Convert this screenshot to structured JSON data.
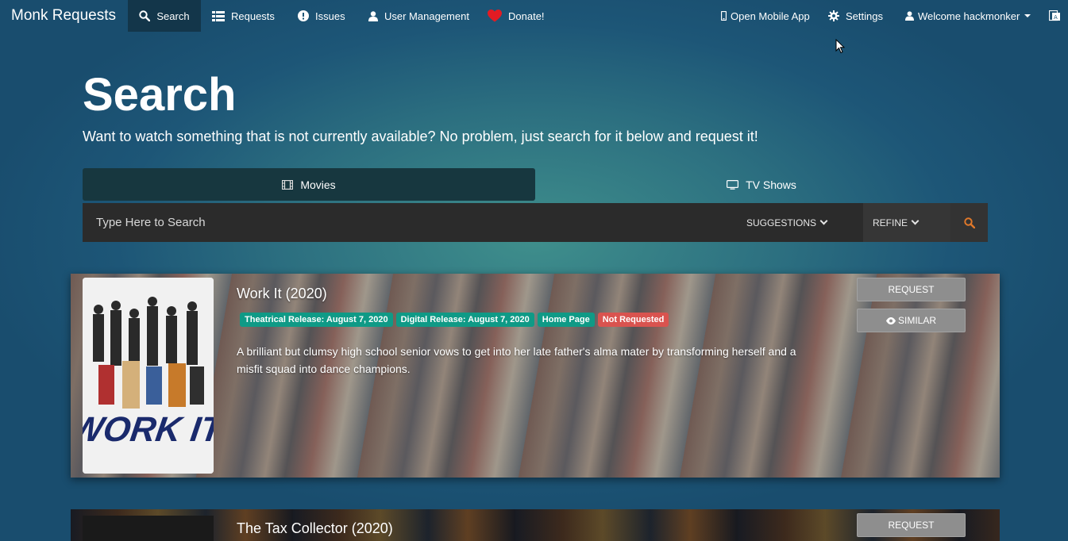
{
  "app": {
    "brand": "Monk Requests"
  },
  "nav": {
    "search": "Search",
    "requests": "Requests",
    "issues": "Issues",
    "user_management": "User Management",
    "donate": "Donate!",
    "mobile_app": "Open Mobile App",
    "settings": "Settings",
    "welcome": "Welcome hackmonker"
  },
  "hero": {
    "title": "Search",
    "subtitle": "Want to watch something that is not currently available? No problem, just search for it below and request it!"
  },
  "tabs": [
    {
      "label": "Movies",
      "active": true,
      "icon": "film-icon"
    },
    {
      "label": "TV Shows",
      "active": false,
      "icon": "tv-icon"
    }
  ],
  "search": {
    "placeholder": "Type Here to Search",
    "suggestions_label": "SUGGESTIONS",
    "refine_label": "REFINE"
  },
  "results": [
    {
      "title": "Work It (2020)",
      "badges": [
        {
          "text": "Theatrical Release: August 7, 2020",
          "color": "#0f9a86"
        },
        {
          "text": "Digital Release: August 7, 2020",
          "color": "#0f9a86"
        },
        {
          "text": "Home Page",
          "color": "#0f9a86"
        },
        {
          "text": "Not Requested",
          "color": "#d9534f"
        }
      ],
      "overview": "A brilliant but clumsy high school senior vows to get into her late father's alma mater by transforming herself and a misfit squad into dance champions.",
      "request_label": "REQUEST",
      "similar_label": "SIMILAR",
      "poster_text": "WORK IT"
    },
    {
      "title": "The Tax Collector (2020)",
      "request_label": "REQUEST"
    }
  ],
  "colors": {
    "accent_orange": "#e0782a",
    "badge_teal": "#0f9a86",
    "badge_red": "#d9534f",
    "donate_heart": "#e31b23"
  }
}
